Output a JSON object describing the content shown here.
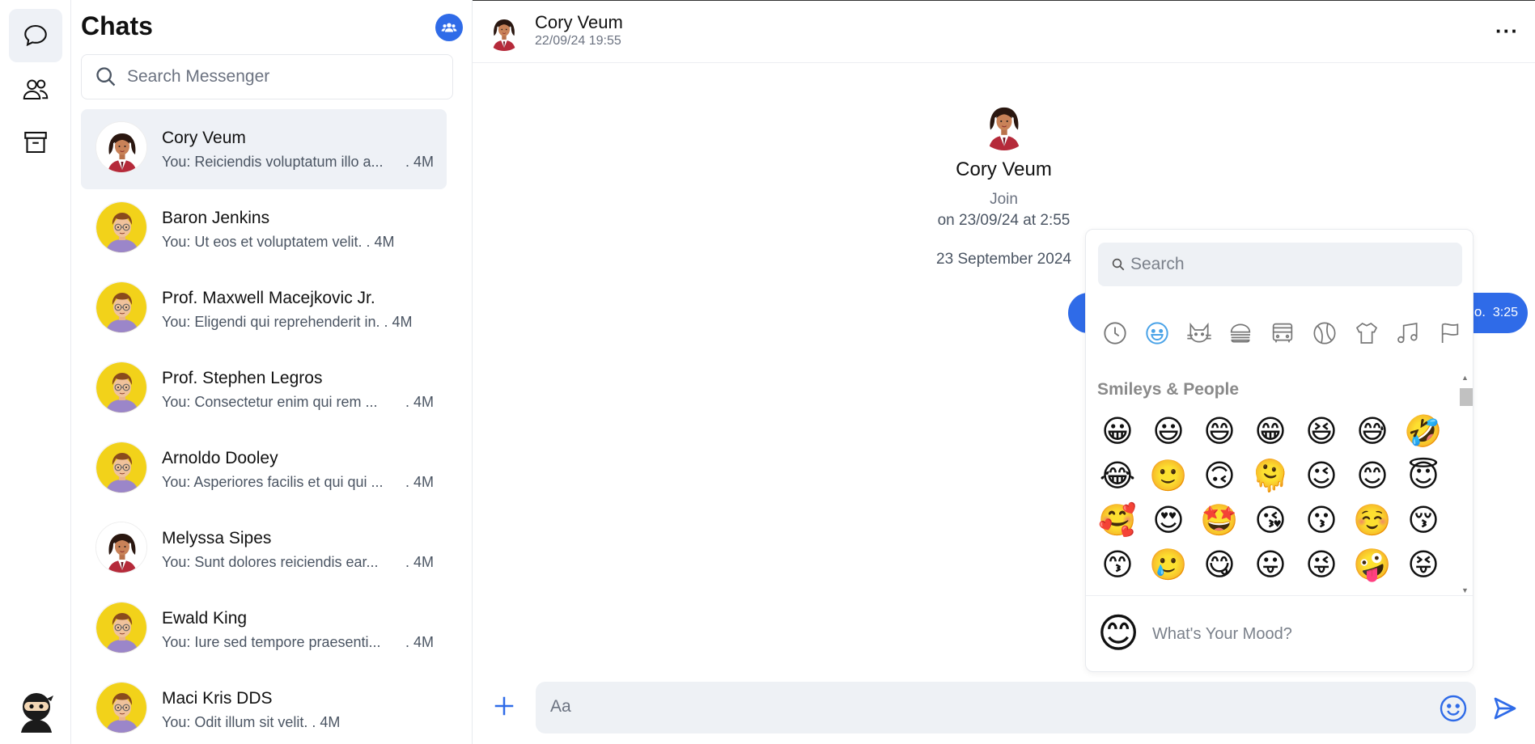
{
  "sidebar": {
    "title": "Chats",
    "search_placeholder": "Search Messenger"
  },
  "chats": [
    {
      "name": "Cory Veum",
      "preview": "You: Reiciendis voluptatum illo a...",
      "time": ". 4M",
      "avatar": "woman",
      "active": true
    },
    {
      "name": "Baron Jenkins",
      "preview": "You: Ut eos et voluptatem velit. . 4M",
      "time": "",
      "avatar": "man",
      "active": false
    },
    {
      "name": "Prof. Maxwell Macejkovic Jr.",
      "preview": "You: Eligendi qui reprehenderit in. . 4M",
      "time": "",
      "avatar": "man",
      "active": false
    },
    {
      "name": "Prof. Stephen Legros",
      "preview": "You: Consectetur enim qui rem ...",
      "time": ". 4M",
      "avatar": "man",
      "active": false
    },
    {
      "name": "Arnoldo Dooley",
      "preview": "You: Asperiores facilis et qui qui ...",
      "time": ". 4M",
      "avatar": "man",
      "active": false
    },
    {
      "name": "Melyssa Sipes",
      "preview": "You: Sunt dolores reiciendis ear...",
      "time": ". 4M",
      "avatar": "woman",
      "active": false
    },
    {
      "name": "Ewald King",
      "preview": "You: Iure sed tempore praesenti...",
      "time": ". 4M",
      "avatar": "man",
      "active": false
    },
    {
      "name": "Maci Kris DDS",
      "preview": "You: Odit illum sit velit. . 4M",
      "time": "",
      "avatar": "man",
      "active": false
    }
  ],
  "header": {
    "name": "Cory Veum",
    "subtitle": "22/09/24 19:55"
  },
  "intro": {
    "name": "Cory Veum",
    "join": "Join",
    "on": "on 23/09/24 at 2:55"
  },
  "date_separator": "23 September 2024",
  "message": {
    "text": "o.",
    "time": "3:25"
  },
  "picker": {
    "search_placeholder": "Search",
    "section": "Smileys & People",
    "categories": [
      "recent-icon",
      "smiley-icon",
      "cat-icon",
      "burger-icon",
      "bus-icon",
      "ball-icon",
      "shirt-icon",
      "music-icon",
      "flag-icon"
    ],
    "emojis": [
      "😀",
      "😃",
      "😄",
      "😁",
      "😆",
      "😅",
      "🤣",
      "😂",
      "🙂",
      "🙃",
      "🫠",
      "😉",
      "😊",
      "😇",
      "🥰",
      "😍",
      "🤩",
      "😘",
      "😗",
      "☺️",
      "😚",
      "😙",
      "🥲",
      "😋",
      "😛",
      "😜",
      "🤪",
      "😝"
    ],
    "mood_emoji": "😊",
    "mood_placeholder": "What's Your Mood?"
  },
  "composer": {
    "placeholder": "Aa"
  },
  "colors": {
    "accent": "#2f6be8",
    "active_bg": "#eef1f6"
  }
}
